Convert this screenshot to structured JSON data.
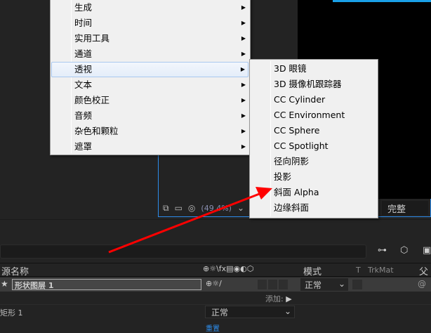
{
  "main_menu": {
    "items": [
      {
        "label": "生成"
      },
      {
        "label": "时间"
      },
      {
        "label": "实用工具"
      },
      {
        "label": "通道"
      },
      {
        "label": "透视",
        "highlighted": true
      },
      {
        "label": "文本"
      },
      {
        "label": "颜色校正"
      },
      {
        "label": "音频"
      },
      {
        "label": "杂色和颗粒"
      },
      {
        "label": "遮罩"
      }
    ]
  },
  "sub_menu": {
    "items": [
      {
        "label": "3D 眼镜"
      },
      {
        "label": "3D 摄像机跟踪器"
      },
      {
        "label": "CC Cylinder"
      },
      {
        "label": "CC Environment"
      },
      {
        "label": "CC Sphere"
      },
      {
        "label": "CC Spotlight"
      },
      {
        "label": "径向阴影"
      },
      {
        "label": "投影"
      },
      {
        "label": "斜面 Alpha"
      },
      {
        "label": "边缘斜面"
      }
    ]
  },
  "viewer": {
    "zoom": "(49.4%)",
    "quality": "完整"
  },
  "timeline": {
    "col_source": "源名称",
    "col_mode": "模式",
    "col_t": "T",
    "col_trkmat": "TrkMat",
    "col_parent": "父级",
    "layer_name": "形状图层 1",
    "layer_mode": "正常",
    "add_label": "添加:",
    "sub_name": "矩形 1",
    "sub_mode": "正常",
    "reset": "重置"
  },
  "colors": {
    "accent": "#2d8ceb",
    "arrow": "#ff0000"
  }
}
